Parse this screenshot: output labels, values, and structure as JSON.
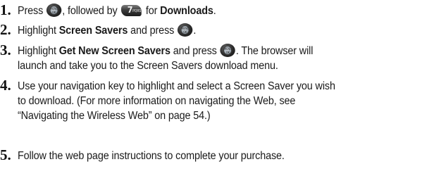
{
  "icons": {
    "menu_ok_key": {
      "name": "menu-ok-key-icon",
      "label_top": "MENU",
      "label_bottom": "OK"
    },
    "key_7": {
      "name": "key-7-pqrs-icon",
      "digit": "7",
      "letters": "PQRS"
    }
  },
  "steps": [
    {
      "number": "1.",
      "segments": {
        "a": "Press ",
        "b": ", followed by ",
        "c": " for ",
        "d": "Downloads",
        "e": "."
      }
    },
    {
      "number": "2.",
      "segments": {
        "a": "Highlight ",
        "b": "Screen Savers",
        "c": " and press ",
        "d": "."
      }
    },
    {
      "number": "3.",
      "segments": {
        "a": "Highlight ",
        "b": "Get New Screen Savers",
        "c": " and press ",
        "d": ". The browser will",
        "line2": "launch and take you to the Screen Savers download menu."
      }
    },
    {
      "number": "4.",
      "lines": [
        "Use your navigation key to highlight and select a Screen Saver you wish",
        "to download. (For more information on navigating the Web, see",
        "“Navigating the Wireless Web” on page 54.)"
      ]
    },
    {
      "number": "5.",
      "lines": [
        "Follow the web page instructions to complete your purchase."
      ]
    }
  ]
}
